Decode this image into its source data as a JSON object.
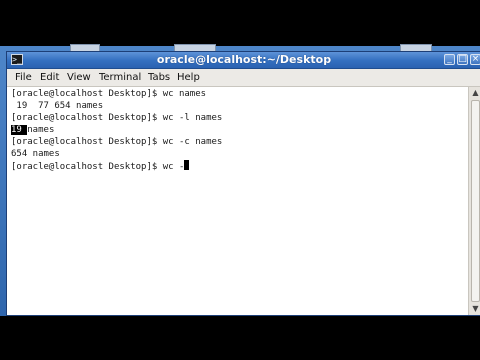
{
  "window": {
    "title": "oracle@localhost:~/Desktop",
    "terminal_icon": "terminal-icon"
  },
  "menubar": {
    "items": [
      "File",
      "Edit",
      "View",
      "Terminal",
      "Tabs",
      "Help"
    ]
  },
  "terminal": {
    "lines": [
      "[oracle@localhost Desktop]$ wc names",
      " 19  77 654 names",
      "[oracle@localhost Desktop]$ wc -l names",
      "names",
      "[oracle@localhost Desktop]$ wc -c names",
      "654 names",
      "[oracle@localhost Desktop]$ wc -"
    ],
    "selected_text": "19",
    "selected_trailing": " "
  },
  "colors": {
    "titlebar": "#336fbf",
    "desktop": "#3a72bb",
    "terminal_bg": "#ffffff"
  }
}
